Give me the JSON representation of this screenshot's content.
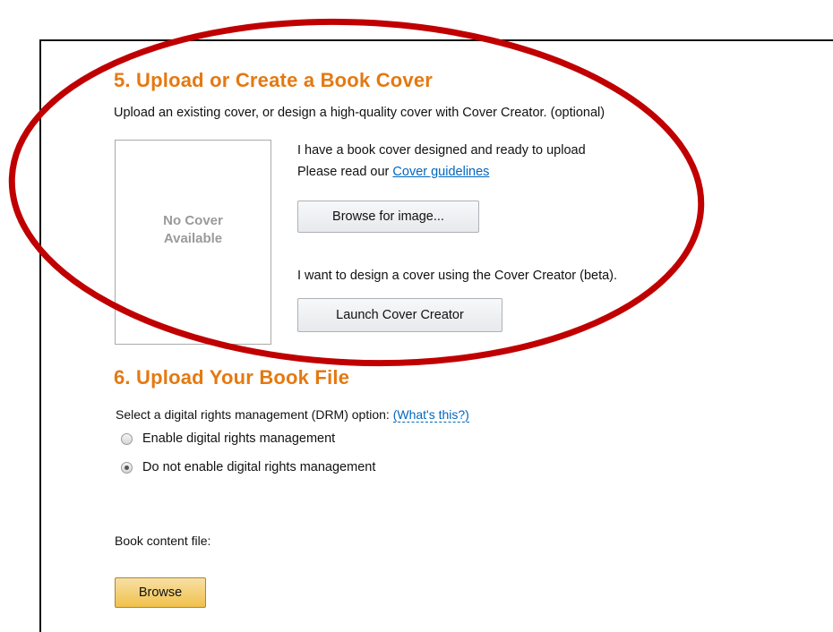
{
  "section5": {
    "title": "5. Upload or Create a Book Cover",
    "subtitle": "Upload an existing cover, or design a high-quality cover with Cover Creator. (optional)",
    "no_cover_line1": "No Cover",
    "no_cover_line2": "Available",
    "have_cover_text": "I have a book cover designed and ready to upload",
    "guidelines_prefix": "Please read our ",
    "guidelines_link": "Cover guidelines",
    "browse_image_button": "Browse for image...",
    "design_cover_text": "I want to design a cover using the Cover Creator (beta).",
    "launch_button": "Launch Cover Creator"
  },
  "section6": {
    "title": "6. Upload Your Book File",
    "drm_prompt": "Select a digital rights management (DRM) option: ",
    "drm_help_link": "(What's this?)",
    "drm_options": [
      {
        "label": "Enable digital rights management",
        "selected": false
      },
      {
        "label": "Do not enable digital rights management",
        "selected": true
      }
    ],
    "content_file_label": "Book content file:",
    "browse_button": "Browse"
  },
  "colors": {
    "heading_orange": "#e47911",
    "link_blue": "#0066c0",
    "annotation_red": "#c00000"
  },
  "annotation": "red-ellipse-highlight"
}
